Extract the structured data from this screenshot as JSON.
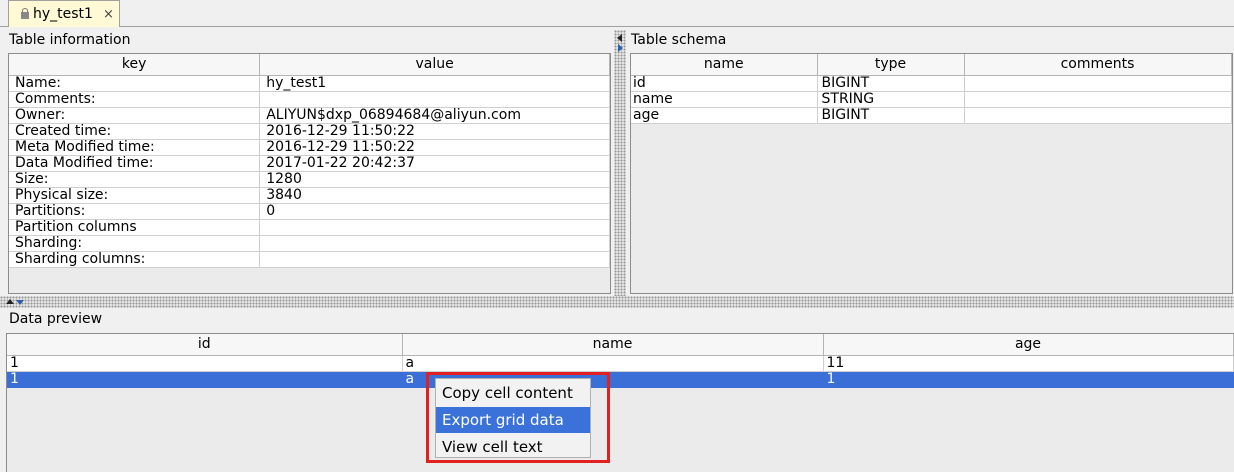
{
  "tab": {
    "label": "hy_test1",
    "close": "×"
  },
  "table_info": {
    "title": "Table information",
    "headers": [
      "key",
      "value"
    ],
    "rows": [
      [
        "Name:",
        "hy_test1"
      ],
      [
        "Comments:",
        ""
      ],
      [
        "Owner:",
        "ALIYUN$dxp_06894684@aliyun.com"
      ],
      [
        "Created time:",
        "2016-12-29 11:50:22"
      ],
      [
        "Meta Modified time:",
        "2016-12-29 11:50:22"
      ],
      [
        "Data Modified time:",
        "2017-01-22 20:42:37"
      ],
      [
        "Size:",
        "1280"
      ],
      [
        "Physical size:",
        "3840"
      ],
      [
        "Partitions:",
        "0"
      ],
      [
        "Partition columns",
        ""
      ],
      [
        "Sharding:",
        ""
      ],
      [
        "Sharding columns:",
        ""
      ]
    ]
  },
  "table_schema": {
    "title": "Table schema",
    "headers": [
      "name",
      "type",
      "comments"
    ],
    "rows": [
      [
        "id",
        "BIGINT",
        ""
      ],
      [
        "name",
        "STRING",
        ""
      ],
      [
        "age",
        "BIGINT",
        ""
      ]
    ]
  },
  "data_preview": {
    "title": "Data preview",
    "headers": [
      "id",
      "name",
      "age"
    ],
    "rows": [
      [
        "1",
        "a",
        "11"
      ],
      [
        "1",
        "a",
        "1"
      ]
    ],
    "selected_row": 1
  },
  "context_menu": {
    "items": [
      "Copy cell content",
      "Export grid data",
      "View cell text"
    ],
    "highlighted": 1
  },
  "colors": {
    "selection": "#3a6fd8",
    "menu_highlight": "#3a72d9",
    "annotation_border": "#e32020",
    "tab_background": "#fff9d6"
  }
}
